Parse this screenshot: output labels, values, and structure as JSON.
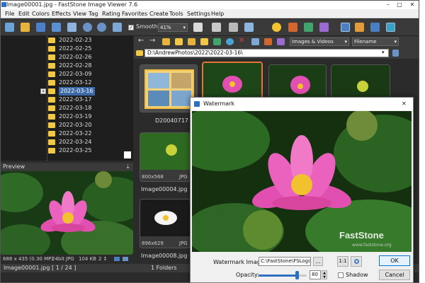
{
  "app": {
    "title": "Image00001.jpg - FastStone Image Viewer 7.6",
    "window_controls": {
      "minimize": "–",
      "maximize": "□",
      "close": "✕"
    }
  },
  "menu": [
    "File",
    "Edit",
    "Colors",
    "Effects",
    "View",
    "Tag",
    "Rating",
    "Favorites",
    "Create",
    "Tools",
    "Settings",
    "Help"
  ],
  "toolbar": {
    "smooth_label": "Smooth",
    "smooth_checked": true,
    "zoom_value": "41%"
  },
  "folder_tree": {
    "items": [
      "2022-02-23",
      "2022-02-25",
      "2022-02-26",
      "2022-02-28",
      "2022-03-09",
      "2022-03-12",
      "2022-03-16",
      "2022-03-17",
      "2022-03-18",
      "2022-03-19",
      "2022-03-20",
      "2022-03-22",
      "2022-03-24",
      "2022-03-25"
    ],
    "selected_index": 6,
    "expander": "+"
  },
  "preview": {
    "header": "Preview",
    "pin": "⇣",
    "info": {
      "dims": "688 x 435 (0.30 MP)",
      "bits": "24bit",
      "format": "JPG",
      "size": "104 KB",
      "extra": "2 ↕"
    }
  },
  "browser": {
    "filter": "Images & Videos",
    "sort": "Filename",
    "address": "D:\\AndrewPhotos\\2022\\2022-03-16\\",
    "thumbs": [
      {
        "label": "D20040717",
        "dims": "",
        "fmt": ""
      },
      {
        "label": "",
        "dims": "",
        "fmt": ""
      },
      {
        "label": "",
        "dims": "",
        "fmt": ""
      },
      {
        "label": "",
        "dims": "",
        "fmt": ""
      },
      {
        "label": "Image00004.jpg",
        "dims": "800x568",
        "fmt": "JPG"
      },
      {
        "label": "Image00008.jpg",
        "dims": "896x629",
        "fmt": "JPG"
      }
    ]
  },
  "status": {
    "file": "Image00001.jpg [ 1 / 24 ]",
    "folders": "1 Folders"
  },
  "watermark": {
    "title": "Watermark",
    "close": "✕",
    "image_label": "Watermark Image:",
    "image_path": "C:\\FastStone\\FSLogo.",
    "browse": "...",
    "ratio": "1:1",
    "opacity_label": "Opacity:",
    "opacity_value": "80",
    "opacity_fraction": 0.8,
    "shadow_label": "Shadow",
    "ok": "OK",
    "cancel": "Cancel",
    "overlay_text": "FastStone",
    "overlay_sub": "www.faststone.org"
  },
  "colors": {
    "selection": "#3d6aa8",
    "thumb_highlight": "#e0762f",
    "folder": "#f2c744",
    "lotus": "#e14fb0"
  }
}
